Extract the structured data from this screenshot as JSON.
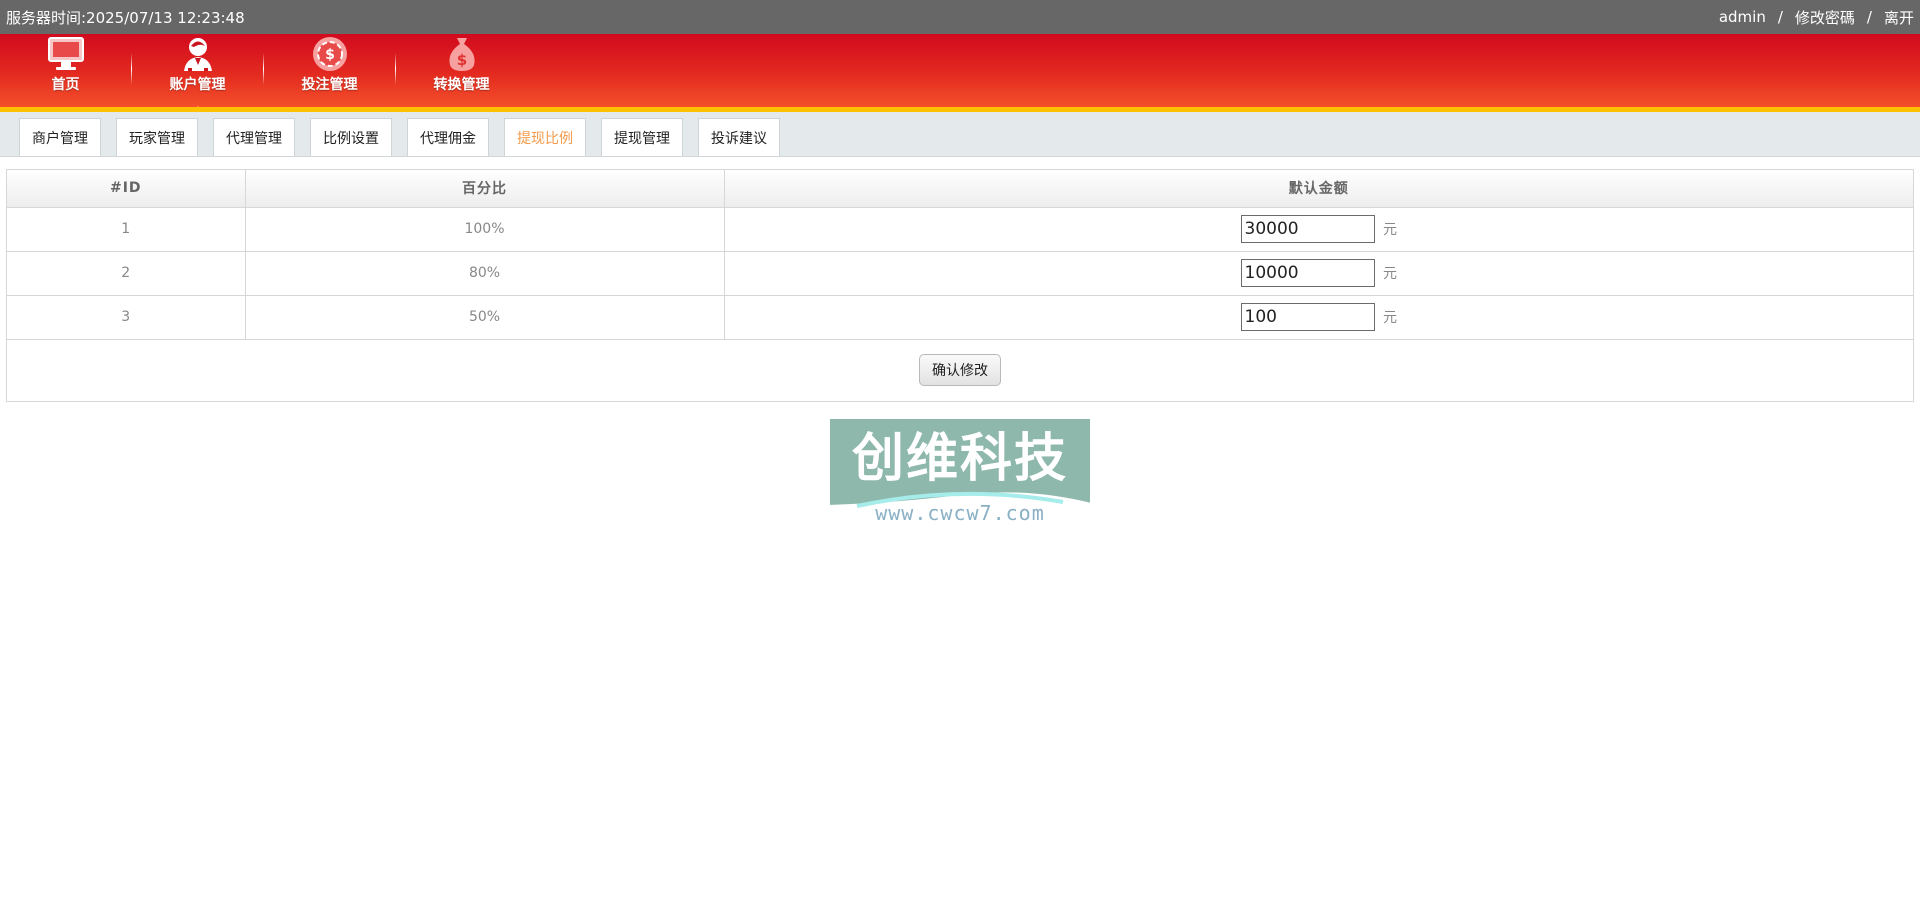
{
  "topbar": {
    "server_time_label": "服务器时间:2025/07/13 12:23:48",
    "username": "admin",
    "separator": "/",
    "change_password": "修改密碼",
    "logout": "离开"
  },
  "nav": {
    "items": [
      {
        "label": "首页",
        "icon": "monitor-icon"
      },
      {
        "label": "账户管理",
        "icon": "user-icon"
      },
      {
        "label": "投注管理",
        "icon": "chip-icon"
      },
      {
        "label": "转换管理",
        "icon": "money-bag-icon"
      }
    ],
    "active_index": 1
  },
  "subtabs": {
    "items": [
      "商户管理",
      "玩家管理",
      "代理管理",
      "比例设置",
      "代理佣金",
      "提现比例",
      "提现管理",
      "投诉建议"
    ],
    "active_index": 5
  },
  "table": {
    "headers": [
      "#ID",
      "百分比",
      "默认金额"
    ],
    "rows": [
      {
        "id": "1",
        "percent": "100%",
        "amount": "30000",
        "unit": "元"
      },
      {
        "id": "2",
        "percent": "80%",
        "amount": "10000",
        "unit": "元"
      },
      {
        "id": "3",
        "percent": "50%",
        "amount": "100",
        "unit": "元"
      }
    ],
    "confirm_button": "确认修改"
  },
  "watermark": {
    "title": "创维科技",
    "url": "www.cwcw7.com"
  },
  "colors": {
    "accent_red": "#d10a1e",
    "accent_yellow": "#ffc100",
    "active_tab": "#f29a4a",
    "topbar_gray": "#676767"
  }
}
